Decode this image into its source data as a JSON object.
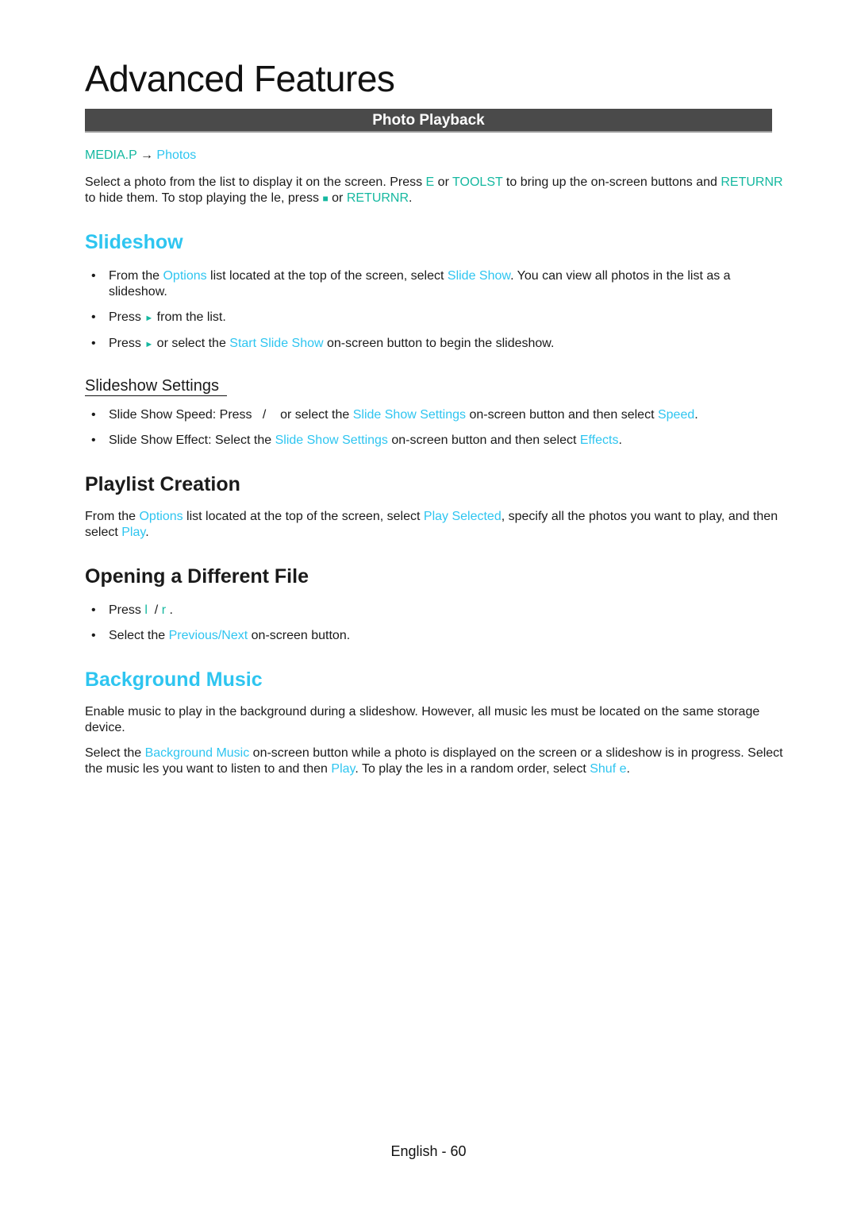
{
  "page_title": "Advanced Features",
  "section_bar": "Photo Playback",
  "breadcrumb": {
    "root": "MEDIA.P",
    "arrow": "→",
    "leaf": "Photos"
  },
  "intro": {
    "t1": "Select a photo from the list to display it on the screen. Press ",
    "k1": "E",
    "t2": " or ",
    "k2": "TOOLST",
    "t3": " to bring up the on-screen buttons and ",
    "k3": "RETURNR",
    "t4": " to hide them. To stop playing the  le, press ",
    "stop_icon": "■",
    "t5": " or ",
    "k4": "RETURNR",
    "t6": "."
  },
  "slideshow": {
    "heading": "Slideshow",
    "items": [
      {
        "t1": "From the ",
        "m1": "Options",
        "t2": " list located at the top of the screen, select ",
        "m2": "Slide Show",
        "t3": ". You can view all photos in the list as a slideshow."
      },
      {
        "t1": "Press ",
        "icon": "►",
        "t2": " from the list."
      },
      {
        "t1": "Press ",
        "icon": "►",
        "t2": " or select the ",
        "m1": "Start Slide Show",
        "t3": " on-screen button to begin the slideshow."
      }
    ],
    "settings": {
      "heading": "Slideshow Settings",
      "items": [
        {
          "t1": "Slide Show Speed: Press   /    or select the ",
          "m1": "Slide Show Settings",
          "t2": " on-screen button and then select ",
          "m2": "Speed",
          "t3": "."
        },
        {
          "t1": "Slide Show Effect: Select the ",
          "m1": "Slide Show Settings",
          "t2": " on-screen button and then select ",
          "m2": "Effects",
          "t3": "."
        }
      ]
    }
  },
  "playlist": {
    "heading": "Playlist Creation",
    "t1": "From the ",
    "m1": "Options",
    "t2": " list located at the top of the screen, select ",
    "m2": "Play Selected",
    "t3": ", specify all the photos you want to play, and then select ",
    "m3": "Play",
    "t4": "."
  },
  "opening": {
    "heading": "Opening a Different File",
    "items": [
      {
        "t1": "Press ",
        "k1": "l",
        "t2": "  / ",
        "k2": "r",
        "t3": " ."
      },
      {
        "t1": "Select the ",
        "m1": "Previous/Next",
        "t2": " on-screen button."
      }
    ]
  },
  "music": {
    "heading": "Background Music",
    "p1": "Enable music to play in the background during a slideshow. However, all music  les must be located on the same storage device.",
    "p2": {
      "t1": "Select the ",
      "m1": "Background Music",
      "t2": " on-screen button while a photo is displayed on the screen or a slideshow is in progress. Select the music  les you want to listen to and then ",
      "m2": "Play",
      "t3": ". To play the  les in a random order, select ",
      "m3": "Shuf e",
      "t4": "."
    }
  },
  "footer": "English - 60",
  "colors": {
    "key_teal": "#15b8a0",
    "menu_cyan": "#2ec5f0",
    "bar_gray": "#4a4a4a"
  }
}
